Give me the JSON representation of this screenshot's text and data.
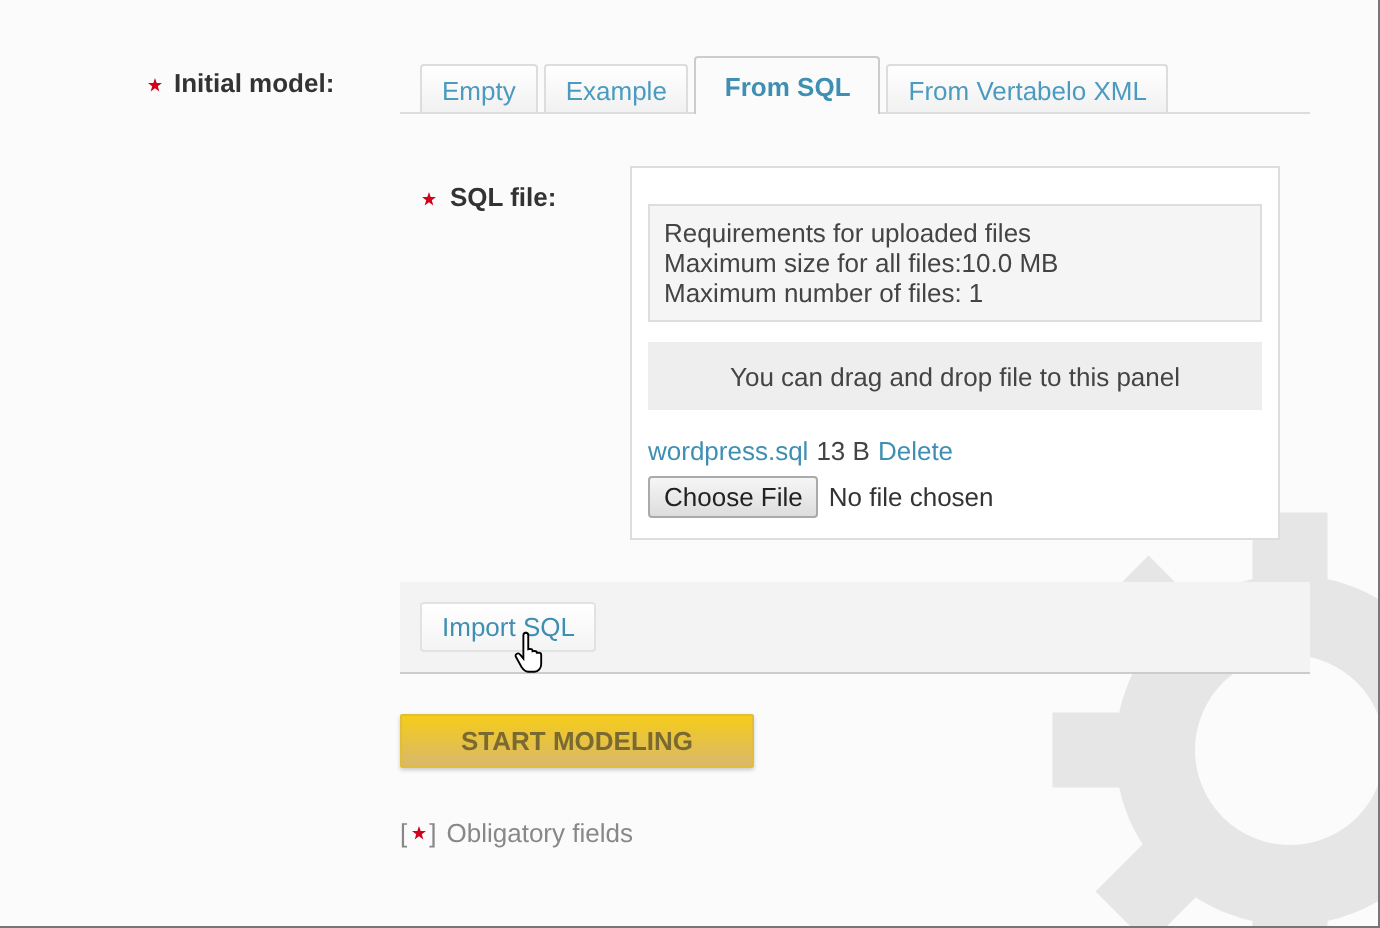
{
  "initial_model": {
    "label": "Initial model:",
    "required": true,
    "tabs": [
      {
        "label": "Empty",
        "selected": false
      },
      {
        "label": "Example",
        "selected": false
      },
      {
        "label": "From SQL",
        "selected": true
      },
      {
        "label": "From Vertabelo XML",
        "selected": false
      }
    ]
  },
  "sql_file": {
    "label": "SQL file:",
    "required": true,
    "requirements": [
      "Requirements for uploaded files",
      "Maximum size for all files:10.0 MB",
      "Maximum number of files: 1"
    ],
    "drop_zone": "You can drag and drop file to this panel",
    "uploaded": {
      "name": "wordpress.sql",
      "size": "13 B",
      "delete": "Delete"
    },
    "choose_button": "Choose File",
    "chosen": "No file chosen"
  },
  "import_button": "Import SQL",
  "start_button": "START MODELING",
  "legend": {
    "open": "[",
    "close": "]",
    "text": "Obligatory fields"
  }
}
